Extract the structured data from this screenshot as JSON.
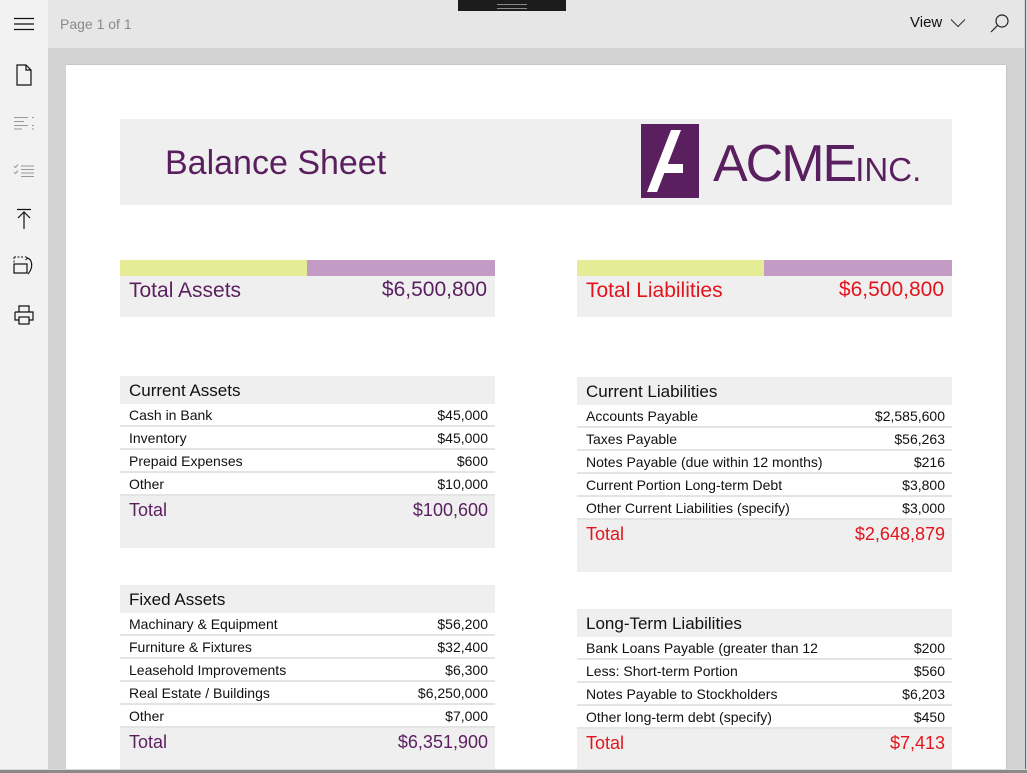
{
  "toolbar": {
    "page_indicator": "Page 1 of 1",
    "view_label": "View",
    "icons": {
      "menu": "hamburger-icon",
      "view_dropdown": "chevron-down-icon",
      "search": "search-icon"
    }
  },
  "sidebar": {
    "items": [
      {
        "name": "document-icon",
        "label": "Document"
      },
      {
        "name": "table-of-contents-icon",
        "label": "Table of contents"
      },
      {
        "name": "checklist-icon",
        "label": "Checklist"
      },
      {
        "name": "go-to-top-icon",
        "label": "Go to top"
      },
      {
        "name": "rotate-icon",
        "label": "Rotate"
      },
      {
        "name": "print-icon",
        "label": "Print"
      }
    ]
  },
  "document": {
    "title": "Balance Sheet",
    "logo": {
      "main": "ACME",
      "suffix": "INC."
    },
    "colors": {
      "brand_purple": "#5a1f5f",
      "liability_red": "#e2151c",
      "bar_yellow": "#e6eb95",
      "bar_lavender": "#c39bc4",
      "panel_gray": "#f0eff0"
    },
    "total_assets": {
      "label": "Total Assets",
      "value": "$6,500,800"
    },
    "total_liabilities": {
      "label": "Total Liabilities",
      "value": "$6,500,800"
    },
    "current_assets": {
      "heading": "Current Assets",
      "rows": [
        {
          "name": "Cash in Bank",
          "amount": "$45,000"
        },
        {
          "name": "Inventory",
          "amount": "$45,000"
        },
        {
          "name": "Prepaid Expenses",
          "amount": "$600"
        },
        {
          "name": "Other",
          "amount": "$10,000"
        }
      ],
      "total_label": "Total",
      "total_value": "$100,600"
    },
    "fixed_assets": {
      "heading": "Fixed Assets",
      "rows": [
        {
          "name": "Machinary & Equipment",
          "amount": "$56,200"
        },
        {
          "name": "Furniture & Fixtures",
          "amount": "$32,400"
        },
        {
          "name": "Leasehold Improvements",
          "amount": "$6,300"
        },
        {
          "name": "Real Estate / Buildings",
          "amount": "$6,250,000"
        },
        {
          "name": "Other",
          "amount": "$7,000"
        }
      ],
      "total_label": "Total",
      "total_value": "$6,351,900"
    },
    "current_liabilities": {
      "heading": "Current Liabilities",
      "rows": [
        {
          "name": "Accounts Payable",
          "amount": "$2,585,600"
        },
        {
          "name": "Taxes Payable",
          "amount": "$56,263"
        },
        {
          "name": "Notes Payable (due within 12 months)",
          "amount": "$216"
        },
        {
          "name": "Current Portion Long-term Debt",
          "amount": "$3,800"
        },
        {
          "name": "Other Current Liabilities (specify)",
          "amount": "$3,000"
        }
      ],
      "total_label": "Total",
      "total_value": "$2,648,879"
    },
    "long_term_liabilities": {
      "heading": "Long-Term Liabilities",
      "rows": [
        {
          "name": "Bank Loans Payable (greater than 12",
          "amount": "$200"
        },
        {
          "name": "Less: Short-term Portion",
          "amount": "$560"
        },
        {
          "name": "Notes Payable to Stockholders",
          "amount": "$6,203"
        },
        {
          "name": "Other long-term debt (specify)",
          "amount": "$450"
        }
      ],
      "total_label": "Total",
      "total_value": "$7,413"
    }
  }
}
